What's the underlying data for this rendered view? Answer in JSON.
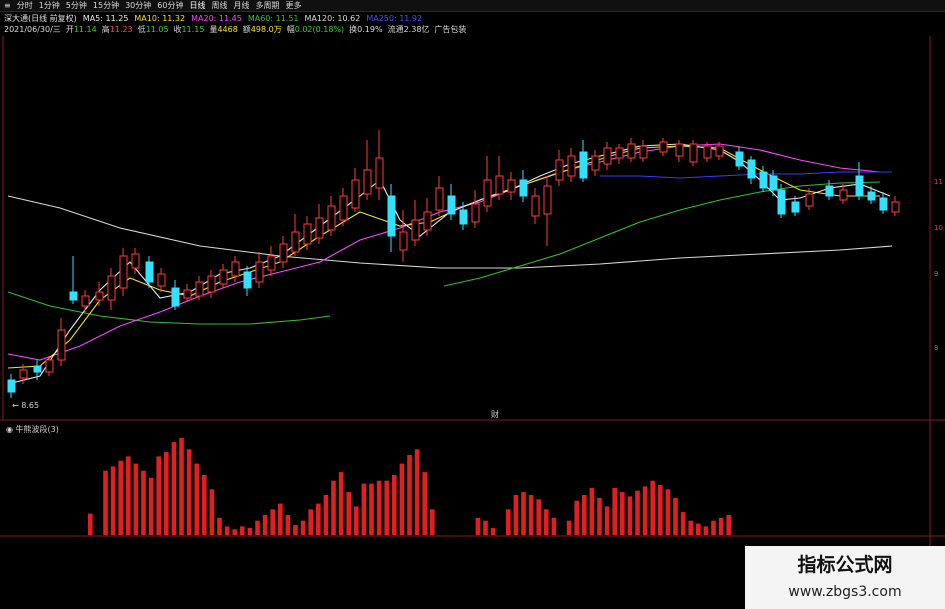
{
  "toolbar": {
    "menu_icon": "≡",
    "items": [
      "分时",
      "1分钟",
      "5分钟",
      "15分钟",
      "30分钟",
      "60分钟",
      "日线",
      "周线",
      "月线",
      "多周期",
      "更多"
    ],
    "active": "日线"
  },
  "header": {
    "name": "深大通(日线 前复权)",
    "ma5": "MA5: 11.25",
    "ma10": "MA10: 11.32",
    "ma20": "MA20: 11.45",
    "ma60": "MA60: 11.51",
    "ma120": "MA120: 10.62",
    "ma250": "MA250: 11.92"
  },
  "quote": {
    "date": "2021/06/30/三",
    "open_label": "开",
    "open": "11.14",
    "high_label": "高",
    "high": "11.23",
    "low_label": "低",
    "low": "11.05",
    "close_label": "收",
    "close": "11.15",
    "vol_label": "量",
    "vol": "4468",
    "amount_label": "额",
    "amount": "498.0万",
    "change_label": "幅",
    "change": "0.02(0.18%)",
    "turnover": "换0.19%",
    "float_cap": "流通2.38亿",
    "tag": "广告包装"
  },
  "low_marker": "8.65",
  "cai_marker": "财",
  "sub_chart": {
    "title": "牛熊波段(3)",
    "values": [
      0,
      0,
      0,
      0,
      0,
      0.15,
      0,
      0.45,
      0.48,
      0.52,
      0.55,
      0.5,
      0.45,
      0.4,
      0.55,
      0.58,
      0.65,
      0.68,
      0.6,
      0.5,
      0.42,
      0.32,
      0.12,
      0.06,
      0.04,
      0.06,
      0.05,
      0.1,
      0.14,
      0.18,
      0.22,
      0.14,
      0.07,
      0.1,
      0.18,
      0.22,
      0.28,
      0.38,
      0.44,
      0.3,
      0.2,
      0.36,
      0.36,
      0.38,
      0.38,
      0.42,
      0.5,
      0.56,
      0.6,
      0.44,
      0.18,
      0,
      0,
      0,
      0,
      0,
      0.12,
      0.1,
      0.05,
      0,
      0.18,
      0.28,
      0.3,
      0.28,
      0.25,
      0.18,
      0.12,
      0,
      0.1,
      0.24,
      0.28,
      0.33,
      0.26,
      0.2,
      0.33,
      0.3,
      0.27,
      0.31,
      0.34,
      0.38,
      0.35,
      0.32,
      0.26,
      0.16,
      0.1,
      0.08,
      0.06,
      0.1,
      0.12,
      0.14
    ]
  },
  "watermark": {
    "title": "指标公式网",
    "url": "www.zbgs3.com"
  },
  "right_axis": [
    "11",
    "10",
    "9",
    "8"
  ],
  "colors": {
    "up": "#ff3d3d",
    "down": "#34e0ff",
    "ma5": "#e8e8e8",
    "ma10": "#f2e21e",
    "ma20": "#ff44ff",
    "ma60": "#30c030",
    "ma120": "#d8d8d8",
    "ma250": "#3a3aff",
    "bar": "#e02020"
  }
}
